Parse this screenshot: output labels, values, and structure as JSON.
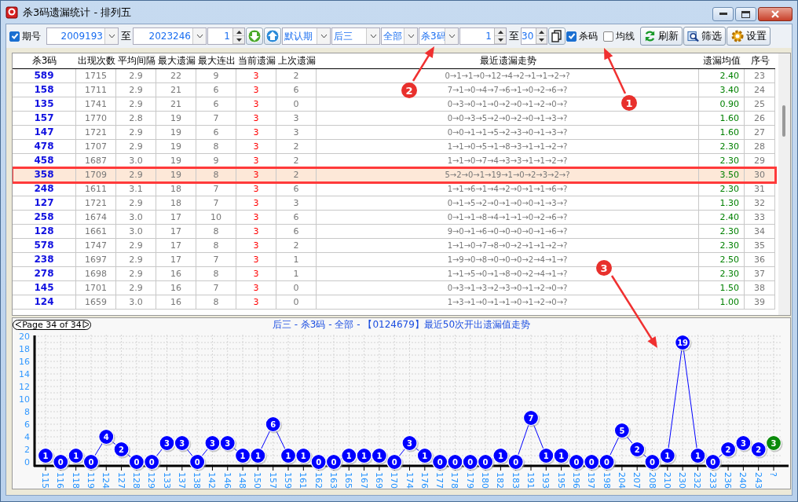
{
  "window": {
    "title": "杀3码遗漏统计 - 排列五"
  },
  "toolbar": [
    {
      "kind": "checkbox",
      "label": "期号",
      "checked": true
    },
    {
      "kind": "number_combo",
      "value": "2009193"
    },
    {
      "kind": "label",
      "text": "至"
    },
    {
      "kind": "number_combo",
      "value": "2023246"
    },
    {
      "kind": "spinner",
      "value": "1"
    },
    {
      "kind": "down_button"
    },
    {
      "kind": "up_button"
    },
    {
      "kind": "combo",
      "value": "默认期"
    },
    {
      "kind": "combo",
      "value": "后三"
    },
    {
      "kind": "combo",
      "value": "全部"
    },
    {
      "kind": "combo",
      "value": "杀3码"
    },
    {
      "kind": "spinner",
      "value": "1"
    },
    {
      "kind": "label",
      "text": "至"
    },
    {
      "kind": "spinner",
      "value": "30"
    },
    {
      "kind": "copy_button"
    },
    {
      "kind": "checkbox",
      "label": "杀码",
      "checked": true
    },
    {
      "kind": "checkbox",
      "label": "均线",
      "checked": false
    },
    {
      "kind": "refresh_button",
      "label": "刷新"
    },
    {
      "kind": "filter_button",
      "label": "筛选"
    },
    {
      "kind": "settings_button",
      "label": "设置"
    }
  ],
  "table": {
    "columns": [
      "杀3码",
      "出现次数",
      "平均间隔",
      "最大遗漏",
      "最大连出",
      "当前遗漏",
      "上次遗漏",
      "最近遗漏走势",
      "遗漏均值",
      "序号"
    ],
    "rows": [
      {
        "selected": false,
        "cells": [
          "589",
          "1715",
          "2.9",
          "22",
          "9",
          "3",
          "2",
          "0→1→1→0→12→4→2→1→1→2→?",
          "2.40",
          "23"
        ]
      },
      {
        "selected": false,
        "cells": [
          "158",
          "1711",
          "2.9",
          "21",
          "6",
          "3",
          "6",
          "7→1→0→4→7→6→1→0→2→6→?",
          "3.40",
          "24"
        ]
      },
      {
        "selected": false,
        "cells": [
          "135",
          "1741",
          "2.9",
          "21",
          "6",
          "3",
          "0",
          "0→3→0→1→0→2→0→1→2→0→?",
          "0.90",
          "25"
        ]
      },
      {
        "selected": false,
        "cells": [
          "157",
          "1770",
          "2.8",
          "19",
          "7",
          "3",
          "3",
          "0→0→3→5→2→0→2→0→1→3→?",
          "1.60",
          "26"
        ]
      },
      {
        "selected": false,
        "cells": [
          "147",
          "1721",
          "2.9",
          "19",
          "6",
          "3",
          "3",
          "0→0→1→1→5→2→3→0→1→3→?",
          "1.60",
          "27"
        ]
      },
      {
        "selected": false,
        "cells": [
          "478",
          "1707",
          "2.9",
          "19",
          "8",
          "3",
          "2",
          "1→1→0→5→1→8→3→1→1→2→?",
          "2.30",
          "28"
        ]
      },
      {
        "selected": false,
        "cells": [
          "458",
          "1687",
          "3.0",
          "19",
          "9",
          "3",
          "2",
          "1→1→0→7→4→3→3→1→1→2→?",
          "2.30",
          "29"
        ]
      },
      {
        "selected": true,
        "cells": [
          "358",
          "1709",
          "2.9",
          "19",
          "8",
          "3",
          "2",
          "5→2→0→1→19→1→0→2→3→2→?",
          "3.50",
          "30"
        ]
      },
      {
        "selected": false,
        "cells": [
          "248",
          "1611",
          "3.1",
          "18",
          "7",
          "3",
          "6",
          "1→1→6→1→4→2→0→1→1→6→?",
          "2.30",
          "31"
        ]
      },
      {
        "selected": false,
        "cells": [
          "127",
          "1721",
          "2.9",
          "18",
          "7",
          "3",
          "3",
          "0→1→5→2→0→1→0→0→1→3→?",
          "1.30",
          "32"
        ]
      },
      {
        "selected": false,
        "cells": [
          "258",
          "1674",
          "3.0",
          "17",
          "10",
          "3",
          "6",
          "0→1→1→8→4→1→1→0→2→6→?",
          "2.40",
          "33"
        ]
      },
      {
        "selected": false,
        "cells": [
          "128",
          "1661",
          "3.0",
          "17",
          "8",
          "3",
          "6",
          "9→0→1→6→0→0→0→0→1→6→?",
          "2.30",
          "34"
        ]
      },
      {
        "selected": false,
        "cells": [
          "578",
          "1747",
          "2.9",
          "17",
          "8",
          "3",
          "2",
          "1→1→0→7→8→0→2→1→1→2→?",
          "2.30",
          "35"
        ]
      },
      {
        "selected": false,
        "cells": [
          "238",
          "1697",
          "2.9",
          "17",
          "7",
          "3",
          "1",
          "1→9→0→8→0→0→0→2→4→1→?",
          "2.50",
          "36"
        ]
      },
      {
        "selected": false,
        "cells": [
          "278",
          "1698",
          "2.9",
          "16",
          "8",
          "3",
          "1",
          "1→1→5→0→1→8→0→2→4→1→?",
          "2.30",
          "37"
        ]
      },
      {
        "selected": false,
        "cells": [
          "145",
          "1701",
          "2.9",
          "16",
          "7",
          "3",
          "0",
          "0→3→1→3→2→3→0→1→2→0→?",
          "1.50",
          "38"
        ]
      },
      {
        "selected": false,
        "cells": [
          "124",
          "1659",
          "3.0",
          "16",
          "8",
          "3",
          "0",
          "1→3→1→0→1→1→0→1→2→0→?",
          "1.00",
          "39"
        ]
      }
    ]
  },
  "chart_panel": {
    "pager": "Page 34 of 34",
    "chart_data": {
      "type": "line",
      "title": "后三 - 杀3码 - 全部 - 【0124679】最近50次开出遗漏值走势",
      "categories": [
        "115",
        "116",
        "118",
        "119",
        "124",
        "127",
        "128",
        "129",
        "133",
        "137",
        "138",
        "142",
        "146",
        "148",
        "150",
        "157",
        "159",
        "161",
        "162",
        "163",
        "165",
        "167",
        "169",
        "170",
        "174",
        "176",
        "177",
        "178",
        "179",
        "180",
        "182",
        "183",
        "191",
        "193",
        "195",
        "196",
        "197",
        "198",
        "204",
        "207",
        "208",
        "210",
        "230",
        "232",
        "233",
        "236",
        "240",
        "243",
        "?"
      ],
      "series": [
        {
          "color": "#0000ff",
          "marker": "circle",
          "values": [
            1,
            0,
            1,
            0,
            4,
            2,
            0,
            0,
            3,
            3,
            0,
            3,
            3,
            1,
            1,
            6,
            1,
            1,
            0,
            0,
            1,
            1,
            1,
            0,
            3,
            1,
            0,
            0,
            0,
            0,
            1,
            0,
            7,
            1,
            1,
            0,
            0,
            0,
            5,
            2,
            0,
            1,
            19,
            1,
            0,
            2,
            3,
            2,
            3
          ]
        }
      ],
      "grid": true,
      "ylim": [
        0,
        20
      ],
      "yticks": [
        0,
        2,
        4,
        6,
        8,
        10,
        12,
        14,
        16,
        18,
        20
      ],
      "data_labels": true
    }
  },
  "callouts": [
    {
      "label": "1"
    },
    {
      "label": "2"
    },
    {
      "label": "3"
    }
  ]
}
